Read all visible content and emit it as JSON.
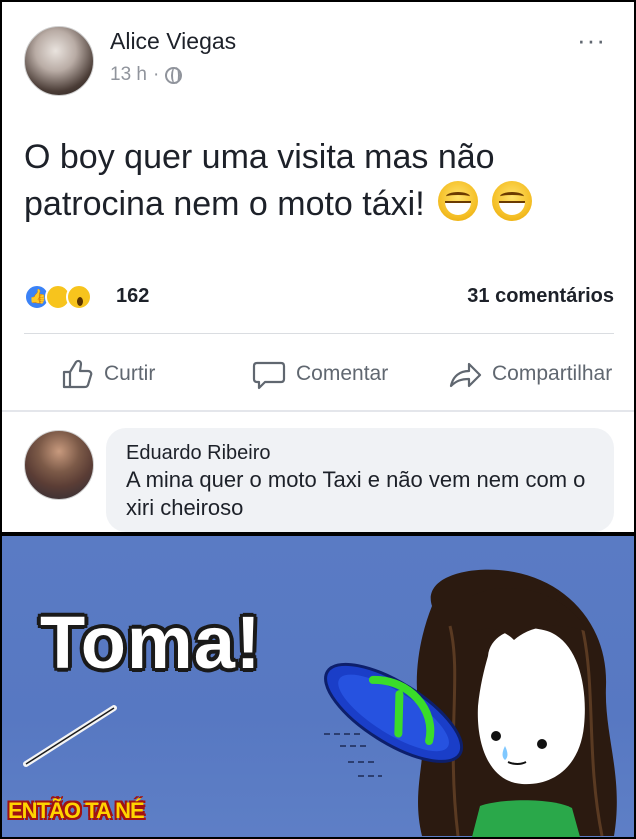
{
  "post": {
    "author": "Alice Viegas",
    "time": "13 h",
    "separator": "·",
    "more_label": "···",
    "text": "O boy quer uma visita mas não patrocina nem o moto táxi!"
  },
  "reactions": {
    "count": "162",
    "comments": "31 comentários"
  },
  "actions": {
    "like": "Curtir",
    "comment": "Comentar",
    "share": "Compartilhar"
  },
  "comment": {
    "name": "Eduardo Ribeiro",
    "text": "A mina quer o moto Taxi e não vem nem com o xiri cheiroso"
  },
  "meme": {
    "caption": "Toma!",
    "watermark": "ENTÃO TA NÉ"
  },
  "colors": {
    "fb_text": "#1d2129",
    "fb_secondary": "#90949c",
    "comment_bubble": "#f0f2f5",
    "meme_background": "#5a7bc4",
    "sandal_blue": "#1a3ec8",
    "sandal_strap": "#3adc2a"
  }
}
